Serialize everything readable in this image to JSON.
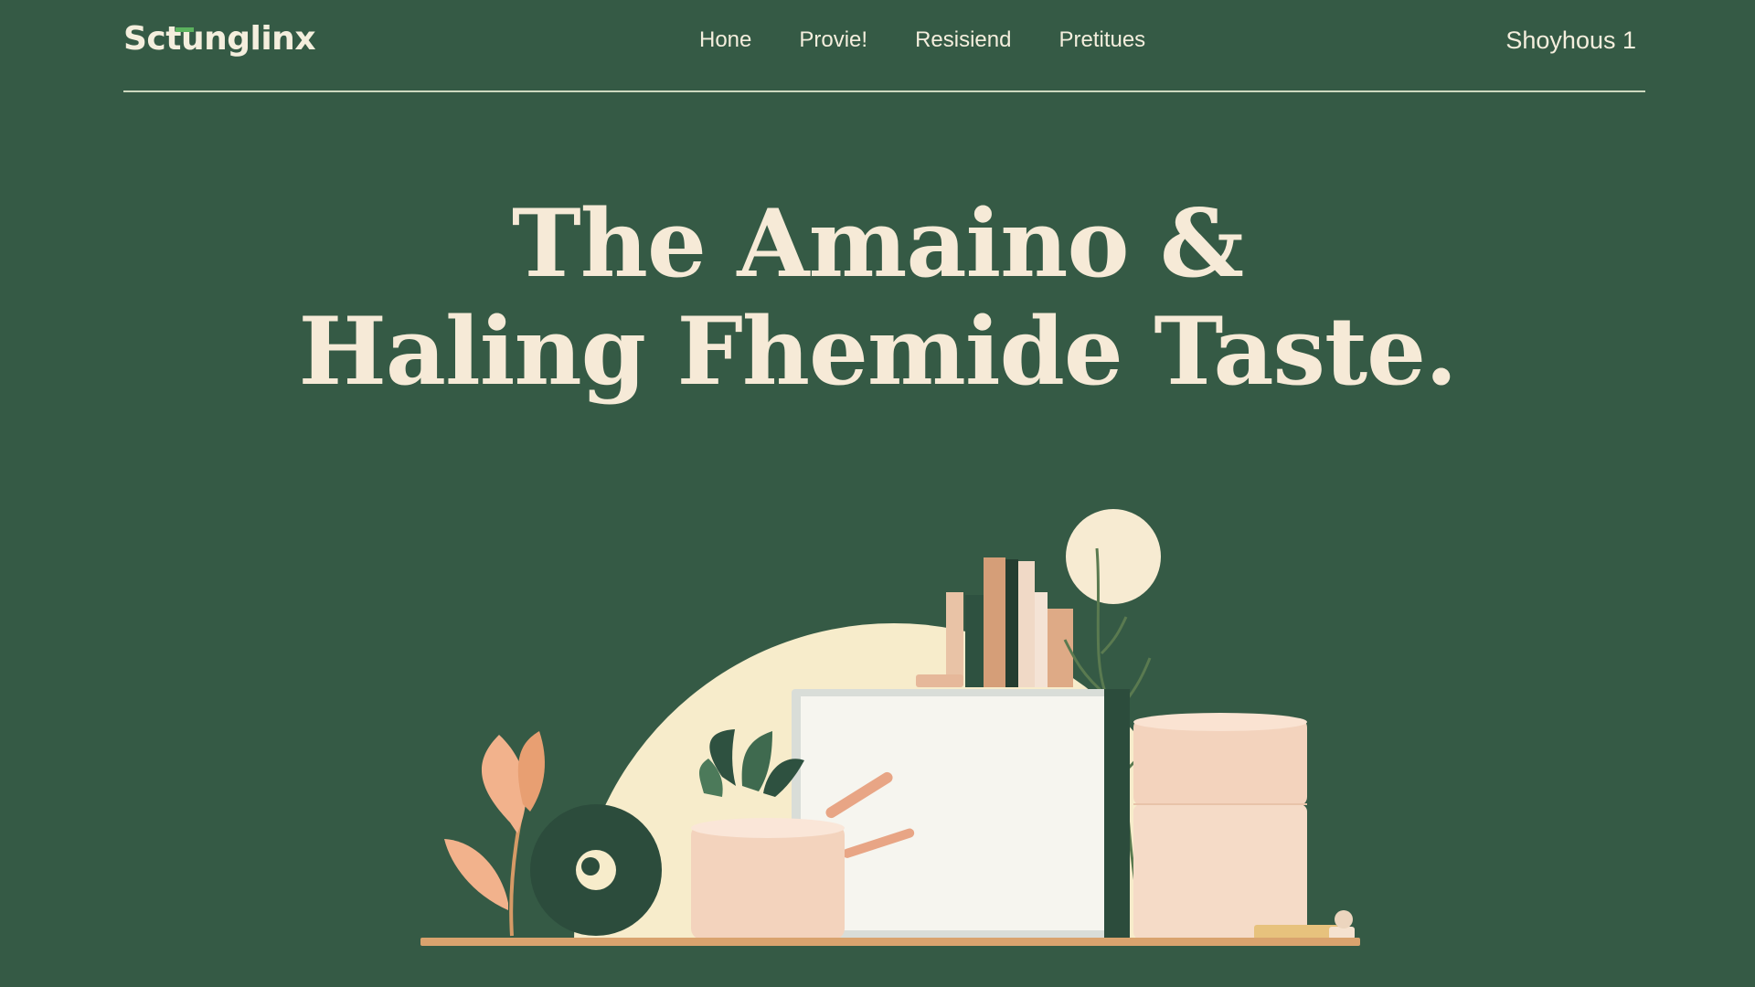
{
  "brand": {
    "name": "Sctunglinx"
  },
  "nav": {
    "items": [
      {
        "label": "Hone"
      },
      {
        "label": "Provie!"
      },
      {
        "label": "Resisiend"
      },
      {
        "label": "Pretitues"
      }
    ]
  },
  "account": {
    "label": "Shoyhous 1"
  },
  "hero": {
    "title_line1": "The Amaino &",
    "title_line2": "Haling Fhemide Taste."
  },
  "colors": {
    "background": "#355a45",
    "text": "#f6ead7",
    "accent": "#5bb25e",
    "sun": "#f7eccb",
    "peach": "#f2b28c",
    "dark_green": "#2e5140"
  }
}
